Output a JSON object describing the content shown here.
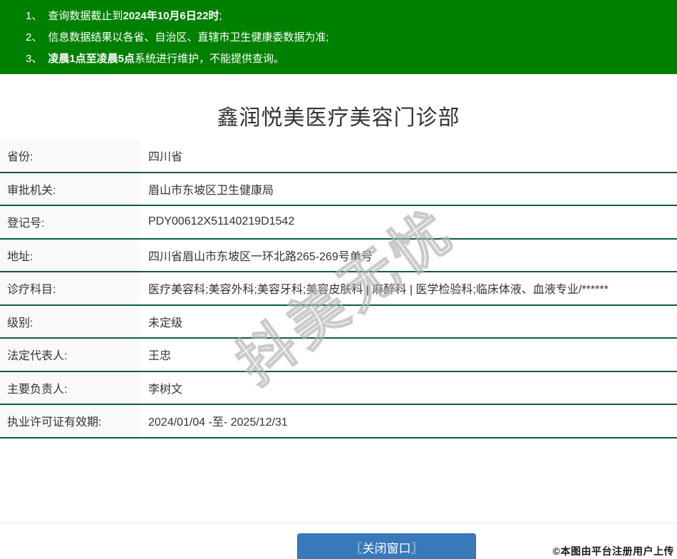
{
  "notice": {
    "items": [
      {
        "prefix": "1、",
        "pre": "查询数据截止到",
        "bold": "2024年10月6日22时",
        "post": ";"
      },
      {
        "prefix": "2、",
        "pre": "信息数据结果以各省、自治区、直辖市卫生健康委数据为准;",
        "bold": "",
        "post": ""
      },
      {
        "prefix": "3、",
        "pre": "",
        "bold": "凌晨1点至凌晨5点",
        "post": "系统进行维护，不能提供查询。"
      }
    ]
  },
  "header": {
    "title": "鑫润悦美医疗美容门诊部"
  },
  "table": {
    "rows": [
      {
        "label": "省份:",
        "value": "四川省"
      },
      {
        "label": "审批机关:",
        "value": "眉山市东坡区卫生健康局"
      },
      {
        "label": "登记号:",
        "value": "PDY00612X51140219D1542"
      },
      {
        "label": "地址:",
        "value": "四川省眉山市东坡区一环北路265-269号单号"
      },
      {
        "label": "诊疗科目:",
        "value": "医疗美容科;美容外科;美容牙科;美容皮肤科 | 麻醉科 | 医学检验科;临床体液、血液专业/******"
      },
      {
        "label": "级别:",
        "value": "未定级"
      },
      {
        "label": "法定代表人:",
        "value": "王忠"
      },
      {
        "label": "主要负责人:",
        "value": "李树文"
      },
      {
        "label": "执业许可证有效期:",
        "value": "2024/01/04 -至- 2025/12/31"
      }
    ]
  },
  "watermark": {
    "text": "抖美无忧"
  },
  "footer": {
    "close_button_label": "〖关闭窗口〗",
    "upload_note": "©本图由平台注册用户上传"
  },
  "colors": {
    "banner_green": "#008000",
    "divider_green": "#0e5e38",
    "button_blue": "#3879b9",
    "label_bg": "#f9f9f9"
  }
}
